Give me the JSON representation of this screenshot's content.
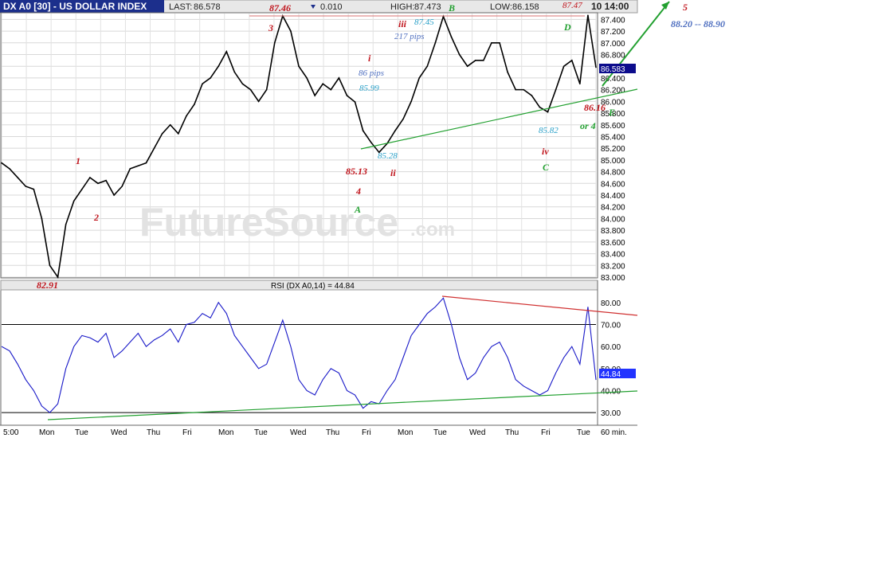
{
  "header": {
    "title": "DX A0 [30] - US DOLLAR INDEX",
    "last_label": "LAST:",
    "last_value": "86.578",
    "change_value": "0.010",
    "high_label": "HIGH:",
    "high_value": "87.473",
    "low_label": "LOW:",
    "low_value": "86.158",
    "datetime_fragment": "10 14:00"
  },
  "price_panel": {
    "y_ticks": [
      "87.400",
      "87.200",
      "87.000",
      "86.800",
      "86.600",
      "86.400",
      "86.200",
      "86.000",
      "85.800",
      "85.600",
      "85.400",
      "85.200",
      "85.000",
      "84.800",
      "84.600",
      "84.400",
      "84.200",
      "84.000",
      "83.800",
      "83.600",
      "83.400",
      "83.200",
      "83.000"
    ],
    "current_price_tag": "86.583",
    "watermark_main": "FutureSource",
    "watermark_sub": ".com"
  },
  "rsi_panel": {
    "title": "RSI (DX A0,14) = 44.84",
    "y_ticks": [
      "80.00",
      "70.00",
      "60.00",
      "50.00",
      "40.00",
      "30.00"
    ],
    "current_tag": "44.84"
  },
  "x_axis": {
    "days": [
      "5:00",
      "Mon",
      "Tue",
      "Wed",
      "Thu",
      "Fri",
      "Mon",
      "Tue",
      "Wed",
      "Thu",
      "Fri",
      "Mon",
      "Tue",
      "Wed",
      "Thu",
      "Fri",
      "Tue"
    ],
    "interval_label": "60 min."
  },
  "annotations": {
    "p8291": "82.91",
    "p8746": "87.46",
    "p8513": "85.13",
    "p8745": "87.45",
    "p8747": "87.47",
    "p8616": "86.16",
    "p8582": "85.82",
    "p8528": "85.28",
    "p8599": "85.99",
    "pips86": "86  pips",
    "pips217": "217  pips",
    "w1": "1",
    "w2": "2",
    "w3": "3",
    "w4": "4",
    "w5": "5",
    "wi": "i",
    "wii": "ii",
    "wiii": "iii",
    "wiv": "iv",
    "wA": "A",
    "wB": "B",
    "wC": "C",
    "wD": "D",
    "wE": "E",
    "or4": "or 4",
    "target": "88.20 -- 88.90"
  },
  "chart_data": [
    {
      "type": "line",
      "title": "DX A0 [30] - US DOLLAR INDEX",
      "interval": "60 min.",
      "ylim": [
        83.0,
        87.5
      ],
      "grid": true,
      "last": 86.578,
      "high": 87.473,
      "low": 86.158,
      "series": [
        {
          "name": "",
          "x": [
            0,
            10,
            20,
            30,
            40,
            50,
            60,
            70,
            80,
            90,
            100,
            110,
            120,
            130,
            140,
            150,
            160,
            170,
            180,
            190,
            200,
            210,
            220,
            230,
            240,
            250,
            260,
            270,
            280,
            290,
            300,
            310,
            320,
            330,
            340,
            350,
            360,
            370,
            380,
            390,
            400,
            410,
            420,
            430,
            440,
            450,
            460,
            470,
            480,
            490,
            500,
            510,
            520,
            530,
            540,
            550,
            560,
            570,
            580,
            590,
            600,
            610,
            620,
            630,
            640,
            650,
            660,
            670,
            680,
            690,
            700,
            710,
            720,
            730,
            740
          ],
          "y": [
            84.95,
            84.85,
            84.7,
            84.55,
            84.5,
            84.0,
            83.2,
            83.0,
            83.9,
            84.3,
            84.5,
            84.7,
            84.6,
            84.65,
            84.4,
            84.55,
            84.85,
            84.9,
            84.95,
            85.2,
            85.45,
            85.6,
            85.45,
            85.75,
            85.95,
            86.3,
            86.4,
            86.6,
            86.85,
            86.5,
            86.3,
            86.2,
            86.0,
            86.2,
            87.0,
            87.46,
            87.2,
            86.6,
            86.4,
            86.1,
            86.3,
            86.2,
            86.4,
            86.1,
            85.99,
            85.5,
            85.3,
            85.13,
            85.28,
            85.5,
            85.7,
            86.0,
            86.4,
            86.6,
            87.0,
            87.45,
            87.1,
            86.8,
            86.6,
            86.7,
            86.7,
            87.0,
            87.0,
            86.5,
            86.2,
            86.2,
            86.1,
            85.9,
            85.82,
            86.2,
            86.6,
            86.7,
            86.3,
            87.47,
            86.583
          ]
        }
      ]
    },
    {
      "type": "line",
      "title": "RSI (DX A0,14) = 44.84",
      "ylim": [
        25,
        85
      ],
      "series": [
        {
          "name": "",
          "x": [
            0,
            10,
            20,
            30,
            40,
            50,
            60,
            70,
            80,
            90,
            100,
            110,
            120,
            130,
            140,
            150,
            160,
            170,
            180,
            190,
            200,
            210,
            220,
            230,
            240,
            250,
            260,
            270,
            280,
            290,
            300,
            310,
            320,
            330,
            340,
            350,
            360,
            370,
            380,
            390,
            400,
            410,
            420,
            430,
            440,
            450,
            460,
            470,
            480,
            490,
            500,
            510,
            520,
            530,
            540,
            550,
            560,
            570,
            580,
            590,
            600,
            610,
            620,
            630,
            640,
            650,
            660,
            670,
            680,
            690,
            700,
            710,
            720,
            730,
            740
          ],
          "y": [
            60,
            58,
            52,
            45,
            40,
            33,
            30,
            34,
            50,
            60,
            65,
            64,
            62,
            66,
            55,
            58,
            62,
            66,
            60,
            63,
            65,
            68,
            62,
            70,
            71,
            75,
            73,
            80,
            75,
            65,
            60,
            55,
            50,
            52,
            62,
            72,
            60,
            45,
            40,
            38,
            45,
            50,
            48,
            40,
            38,
            32,
            35,
            34,
            40,
            45,
            55,
            65,
            70,
            75,
            78,
            82,
            70,
            55,
            45,
            48,
            55,
            60,
            62,
            55,
            45,
            42,
            40,
            38,
            40,
            48,
            55,
            60,
            52,
            78,
            44.84
          ]
        }
      ]
    }
  ]
}
